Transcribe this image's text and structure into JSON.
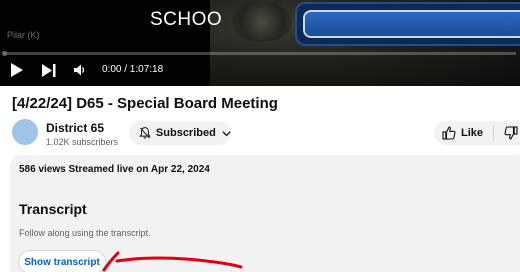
{
  "player": {
    "overlay_text": "SCHOO",
    "caption": "Pilar (K)",
    "time_display": "0:00 / 1:07:18",
    "progress_fraction": 0.0,
    "banner_color": "#2c6ac2"
  },
  "video": {
    "title": "[4/22/24] D65 - Special Board Meeting"
  },
  "channel": {
    "name": "District 65",
    "subscribers": "1.02K subscribers",
    "avatar_color": "#9ec5e8"
  },
  "actions": {
    "subscribe_label": "Subscribed",
    "like_label": "Like",
    "icons": [
      "bell-icon",
      "chevron-down-icon",
      "thumbs-up-icon",
      "thumbs-down-icon"
    ]
  },
  "description": {
    "meta": "586 views  Streamed live on Apr 22, 2024",
    "transcript_heading": "Transcript",
    "transcript_subtitle": "Follow along using the transcript.",
    "show_transcript_label": "Show transcript"
  },
  "colors": {
    "link_blue": "#065fd4",
    "annotation_red": "#e3000f"
  }
}
